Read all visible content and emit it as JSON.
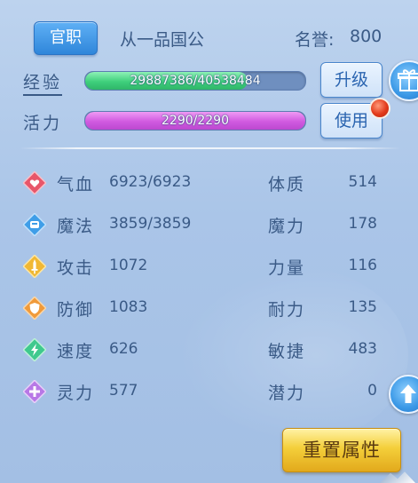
{
  "header": {
    "title_button": "官职",
    "rank": "从一品国公",
    "fame_label": "名誉:",
    "fame_value": "800"
  },
  "experience": {
    "label": "经验",
    "text": "29887386/40538484",
    "current": 29887386,
    "max": 40538484,
    "button": "升级"
  },
  "vitality": {
    "label": "活力",
    "text": "2290/2290",
    "current": 2290,
    "max": 2290,
    "button": "使用"
  },
  "stats": [
    {
      "icon": "heart-icon",
      "name": "气血",
      "value": "6923/6923",
      "attr_name": "体质",
      "attr_value": "514"
    },
    {
      "icon": "magic-icon",
      "name": "魔法",
      "value": "3859/3859",
      "attr_name": "魔力",
      "attr_value": "178"
    },
    {
      "icon": "sword-icon",
      "name": "攻击",
      "value": "1072",
      "attr_name": "力量",
      "attr_value": "116"
    },
    {
      "icon": "shield-icon",
      "name": "防御",
      "value": "1083",
      "attr_name": "耐力",
      "attr_value": "135"
    },
    {
      "icon": "lightning-icon",
      "name": "速度",
      "value": "626",
      "attr_name": "敏捷",
      "attr_value": "483"
    },
    {
      "icon": "spirit-icon",
      "name": "灵力",
      "value": "577",
      "attr_name": "潜力",
      "attr_value": "0"
    }
  ],
  "reset_button": "重置属性",
  "colors": {
    "text": "#3a5a86",
    "exp_fill": "#3fcf7c",
    "vit_fill": "#d05ae0",
    "primary_button": "#2f86da",
    "reset_button": "#f4cf3a"
  }
}
